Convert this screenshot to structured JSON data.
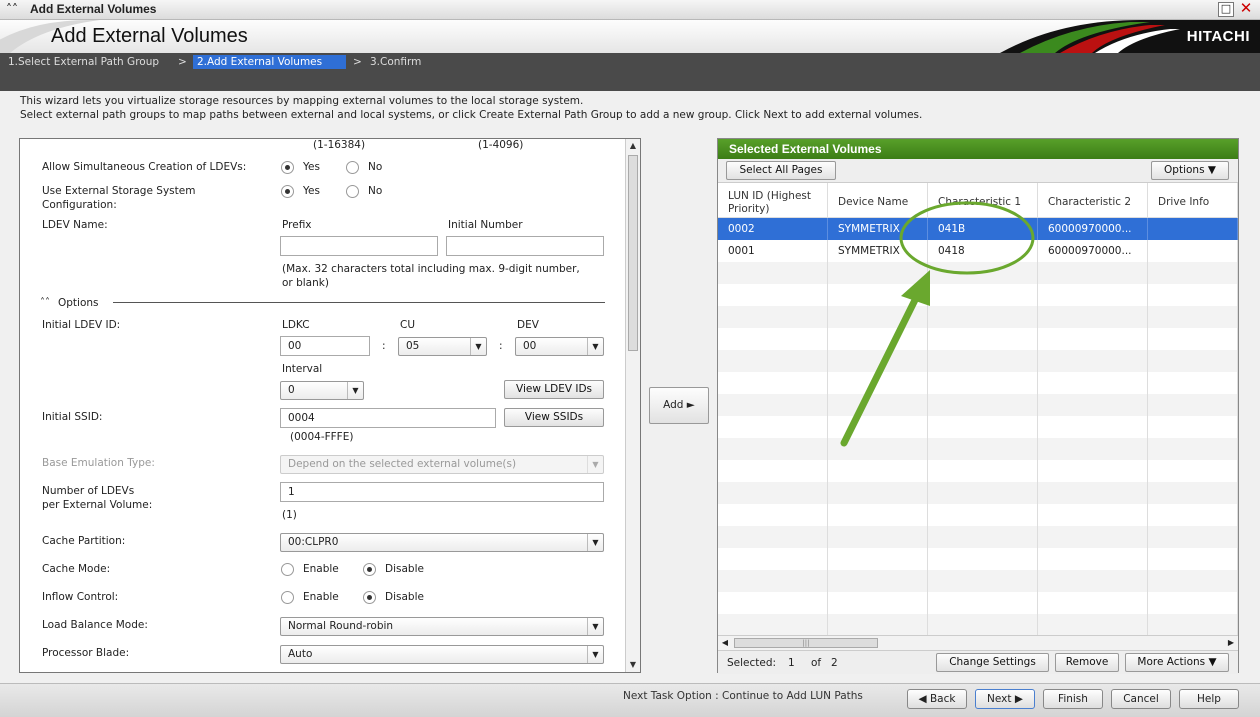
{
  "window": {
    "title": "Add External Volumes",
    "heading": "Add External Volumes",
    "brand": "HITACHI"
  },
  "steps": [
    {
      "label": "1.Select External Path Group"
    },
    {
      "label": "2.Add External Volumes"
    },
    {
      "label": "3.Confirm"
    }
  ],
  "step_separator": ">",
  "description": {
    "line1": "This wizard lets you virtualize storage resources by mapping external volumes to the local storage system.",
    "line2": "Select external path groups to map paths between external and local systems, or click Create External Path Group to add a new group. Click Next to add external volumes."
  },
  "form": {
    "range_1": "(1-16384)",
    "range_2": "(1-4096)",
    "allow_simultaneous": {
      "label": "Allow Simultaneous Creation of LDEVs:",
      "yes": "Yes",
      "no": "No"
    },
    "use_external_config": {
      "label_line1": "Use External Storage System",
      "label_line2": "Configuration:",
      "yes": "Yes",
      "no": "No"
    },
    "ldev_name": {
      "label": "LDEV Name:",
      "prefix_label": "Prefix",
      "initial_number_label": "Initial Number",
      "prefix_value": "",
      "initial_number_value": "",
      "hint_line1": "(Max. 32 characters total including max. 9-digit number,",
      "hint_line2": "or blank)"
    },
    "options_label": "Options",
    "initial_ldev_id": {
      "label": "Initial LDEV ID:",
      "ldkc_label": "LDKC",
      "cu_label": "CU",
      "dev_label": "DEV",
      "ldkc_value": "00",
      "colon": ":",
      "cu_value": "05",
      "dev_value": "00",
      "interval_label": "Interval",
      "interval_value": "0",
      "view_button": "View LDEV IDs"
    },
    "initial_ssid": {
      "label": "Initial SSID:",
      "value": "0004",
      "range": "(0004-FFFE)",
      "view_button": "View SSIDs"
    },
    "base_emulation": {
      "label": "Base Emulation Type:",
      "value": "Depend on the selected external volume(s)"
    },
    "num_ldevs": {
      "label_line1": "Number of LDEVs",
      "label_line2": "per External Volume:",
      "value": "1",
      "range": "(1)"
    },
    "cache_partition": {
      "label": "Cache Partition:",
      "value": "00:CLPR0"
    },
    "cache_mode": {
      "label": "Cache Mode:",
      "enable": "Enable",
      "disable": "Disable"
    },
    "inflow_control": {
      "label": "Inflow Control:",
      "enable": "Enable",
      "disable": "Disable"
    },
    "load_balance": {
      "label": "Load Balance Mode:",
      "value": "Normal Round-robin"
    },
    "processor_blade": {
      "label": "Processor Blade:",
      "value": "Auto"
    }
  },
  "add_button": "Add",
  "selected_volumes": {
    "title": "Selected External Volumes",
    "select_all": "Select All Pages",
    "options": "Options",
    "columns": [
      "LUN ID (Highest Priority)",
      "Device Name",
      "Characteristic 1",
      "Characteristic 2",
      "Drive Info"
    ],
    "rows": [
      {
        "lun": "0002",
        "device": "SYMMETRIX",
        "char1": "041B",
        "char2": "60000970000...",
        "drive": ""
      },
      {
        "lun": "0001",
        "device": "SYMMETRIX",
        "char1": "0418",
        "char2": "60000970000...",
        "drive": ""
      }
    ],
    "selected_label": "Selected:",
    "selected_count": "1",
    "of_label": "of",
    "total_count": "2",
    "change_settings": "Change Settings",
    "remove": "Remove",
    "more_actions": "More Actions"
  },
  "bottom": {
    "next_task": "Next Task Option : Continue to Add LUN Paths",
    "back": "Back",
    "next": "Next",
    "finish": "Finish",
    "cancel": "Cancel",
    "help": "Help"
  },
  "colors": {
    "accent_blue": "#2f6fd6",
    "header_green": "#3c7d16",
    "annotation_green": "#6aa82e"
  }
}
